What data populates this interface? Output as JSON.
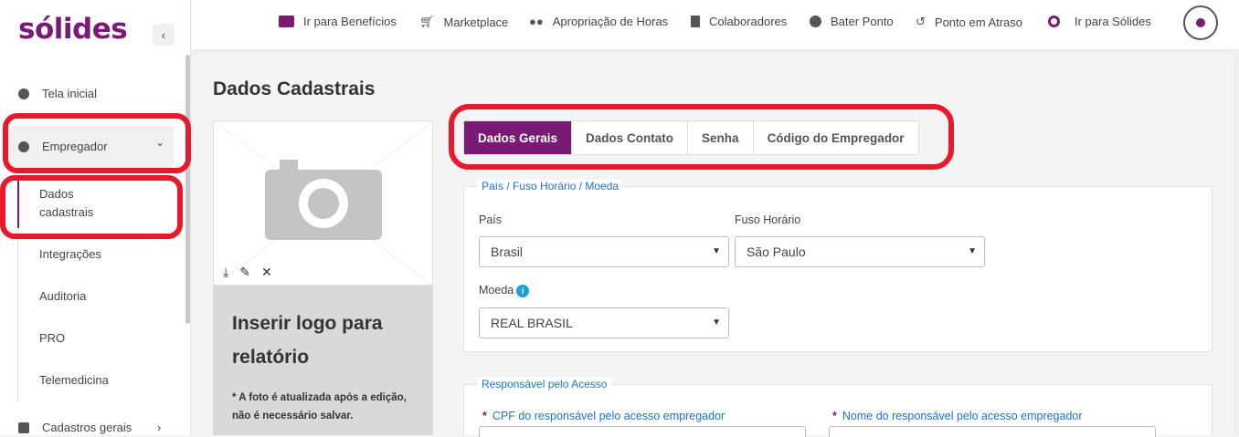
{
  "sidebar": {
    "logo": "sólides",
    "collapse_icon": "‹",
    "home_label": "Tela inicial",
    "employer_label": "Empregador",
    "employer_chevron": "⌄",
    "sub_items": [
      "Dados cadastrais",
      "Integrações",
      "Auditoria",
      "PRO",
      "Telemedicina"
    ],
    "general_label": "Cadastros gerais",
    "general_chevron": "›"
  },
  "topbar": {
    "links": [
      {
        "label": "Ir para Benefícios",
        "icon": "wallet-icon"
      },
      {
        "label": "Marketplace",
        "icon": "cart-icon"
      },
      {
        "label": "Apropriação de Horas",
        "icon": "users-icon"
      },
      {
        "label": "Colaboradores",
        "icon": "book-icon"
      },
      {
        "label": "Bater Ponto",
        "icon": "clock-icon"
      },
      {
        "label": "Ponto em Atraso",
        "icon": "history-icon"
      },
      {
        "label": "Ir para Sólides",
        "icon": "solides-icon"
      }
    ]
  },
  "main": {
    "title": "Dados Cadastrais",
    "logo_card": {
      "title": "Inserir logo para relatório",
      "note": "* A foto é atualizada após a edição, não é necessário salvar."
    },
    "tabs": [
      "Dados Gerais",
      "Dados Contato",
      "Senha",
      "Código do Empregador"
    ],
    "active_tab": 0,
    "section1": {
      "legend": "País / Fuso Horário / Moeda",
      "country_label": "País",
      "country_value": "Brasil",
      "timezone_label": "Fuso Horário",
      "timezone_value": "São Paulo",
      "currency_label": "Moeda",
      "currency_value": "REAL BRASIL"
    },
    "section2": {
      "legend": "Responsável pelo Acesso",
      "cpf_label": "CPF do responsável pelo acesso empregador",
      "name_label": "Nome do responsável pelo acesso empregador",
      "required_mark": "*"
    }
  },
  "colors": {
    "brand": "#7a1a75",
    "highlight": "#e8192c",
    "legend": "#1b73d4"
  }
}
